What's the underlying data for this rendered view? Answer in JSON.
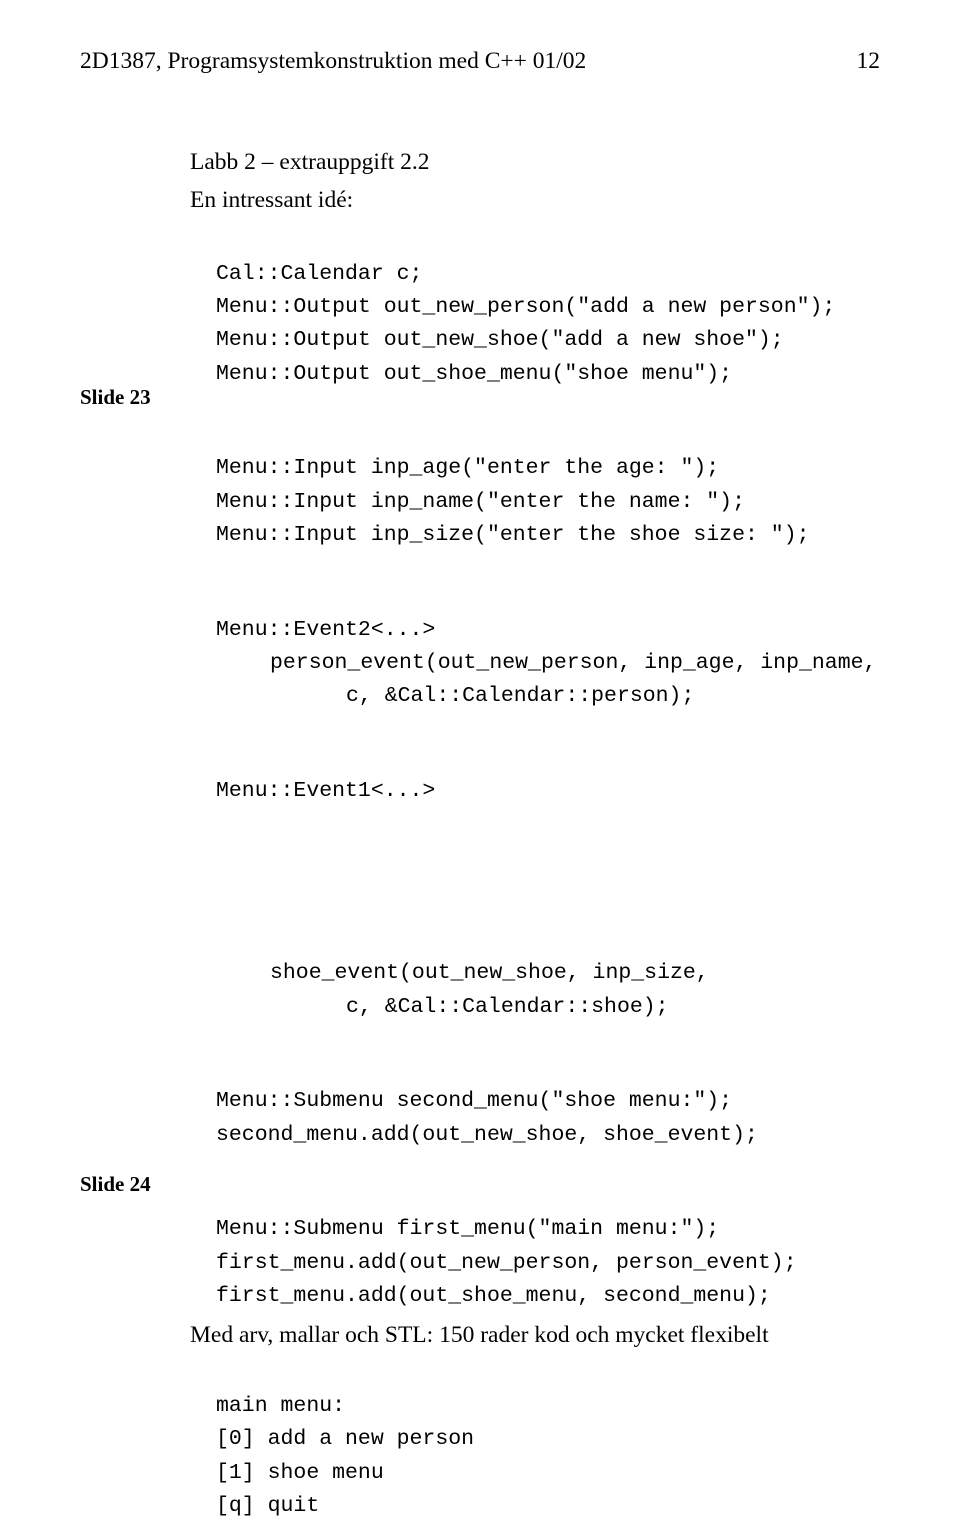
{
  "header": {
    "left": "2D1387, Programsystemkonstruktion med C++ 01/02",
    "right": "12"
  },
  "slide23": {
    "label": "Slide 23",
    "title": "Labb 2 – extrauppgift 2.2",
    "intro": "En intressant idé:",
    "code": {
      "l1": "Cal::Calendar c;",
      "l2": "Menu::Output out_new_person(\"add a new person\");",
      "l3": "Menu::Output out_new_shoe(\"add a new shoe\");",
      "l4": "Menu::Output out_shoe_menu(\"shoe menu\");",
      "l5": "Menu::Input inp_age(\"enter the age: \");",
      "l6": "Menu::Input inp_name(\"enter the name: \");",
      "l7": "Menu::Input inp_size(\"enter the shoe size: \");",
      "l8": "Menu::Event2<...>",
      "l9": "person_event(out_new_person, inp_age, inp_name,",
      "l10": "c, &Cal::Calendar::person);",
      "l11": "Menu::Event1<...>"
    }
  },
  "slide24": {
    "label": "Slide 24",
    "code": {
      "l1": "shoe_event(out_new_shoe, inp_size,",
      "l2": "c, &Cal::Calendar::shoe);",
      "l3": "Menu::Submenu second_menu(\"shoe menu:\");",
      "l4": "second_menu.add(out_new_shoe, shoe_event);",
      "l5": "Menu::Submenu first_menu(\"main menu:\");",
      "l6": "first_menu.add(out_new_person, person_event);",
      "l7": "first_menu.add(out_shoe_menu, second_menu);"
    },
    "summary": "Med arv, mallar och STL: 150 rader kod och mycket flexibelt",
    "menu": {
      "l1": "main menu:",
      "l2": "[0] add a new person",
      "l3": "[1] shoe menu",
      "l4": "[q] quit"
    }
  }
}
